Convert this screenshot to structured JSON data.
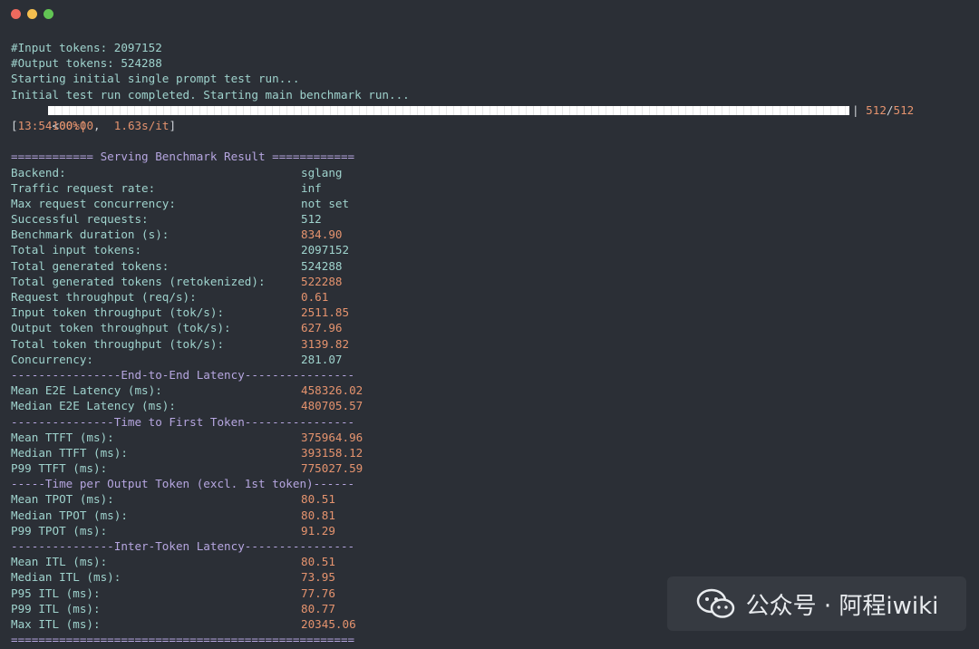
{
  "terminal": {
    "lines": {
      "input_tokens": "#Input tokens: 2097152",
      "output_tokens": "#Output tokens: 524288",
      "starting_initial": "Starting initial single prompt test run...",
      "initial_completed": "Initial test run completed. Starting main benchmark run..."
    },
    "progress": {
      "percent_text": "100%|",
      "fraction": 1.0,
      "count_sep": "| ",
      "count_done": "512",
      "count_slash": "/",
      "count_total": "512",
      "time_open": "[",
      "elapsed": "13:54",
      "time_lt": "<",
      "remaining": "00:00",
      "rate_sep": ",  ",
      "rate": "1.63s/it",
      "time_close": "]"
    },
    "header": "============ Serving Benchmark Result ============",
    "rows": [
      {
        "label": "Backend:",
        "value": "sglang",
        "tone": "cyan"
      },
      {
        "label": "Traffic request rate:",
        "value": "inf",
        "tone": "cyan"
      },
      {
        "label": "Max request concurrency:",
        "value": "not set",
        "tone": "cyan"
      },
      {
        "label": "Successful requests:",
        "value": "512",
        "tone": "cyan"
      },
      {
        "label": "Benchmark duration (s):",
        "value": "834.90",
        "tone": "orange"
      },
      {
        "label": "Total input tokens:",
        "value": "2097152",
        "tone": "cyan"
      },
      {
        "label": "Total generated tokens:",
        "value": "524288",
        "tone": "cyan"
      },
      {
        "label": "Total generated tokens (retokenized):",
        "value": "522288",
        "tone": "orange"
      },
      {
        "label": "Request throughput (req/s):",
        "value": "0.61",
        "tone": "orange"
      },
      {
        "label": "Input token throughput (tok/s):",
        "value": "2511.85",
        "tone": "orange"
      },
      {
        "label": "Output token throughput (tok/s):",
        "value": "627.96",
        "tone": "orange"
      },
      {
        "label": "Total token throughput (tok/s):",
        "value": "3139.82",
        "tone": "orange"
      },
      {
        "label": "Concurrency:",
        "value": "281.07",
        "tone": "cyan"
      }
    ],
    "sections": [
      {
        "title": "----------------End-to-End Latency----------------",
        "rows": [
          {
            "label": "Mean E2E Latency (ms):",
            "value": "458326.02"
          },
          {
            "label": "Median E2E Latency (ms):",
            "value": "480705.57"
          }
        ]
      },
      {
        "title": "---------------Time to First Token----------------",
        "rows": [
          {
            "label": "Mean TTFT (ms):",
            "value": "375964.96"
          },
          {
            "label": "Median TTFT (ms):",
            "value": "393158.12"
          },
          {
            "label": "P99 TTFT (ms):",
            "value": "775027.59"
          }
        ]
      },
      {
        "title": "-----Time per Output Token (excl. 1st token)------",
        "rows": [
          {
            "label": "Mean TPOT (ms):",
            "value": "80.51"
          },
          {
            "label": "Median TPOT (ms):",
            "value": "80.81"
          },
          {
            "label": "P99 TPOT (ms):",
            "value": "91.29"
          }
        ]
      },
      {
        "title": "---------------Inter-Token Latency----------------",
        "rows": [
          {
            "label": "Mean ITL (ms):",
            "value": "80.51"
          },
          {
            "label": "Median ITL (ms):",
            "value": "73.95"
          },
          {
            "label": "P95 ITL (ms):",
            "value": "77.76"
          },
          {
            "label": "P99 ITL (ms):",
            "value": "80.77"
          },
          {
            "label": "Max ITL (ms):",
            "value": "20345.06"
          }
        ]
      }
    ],
    "footer": "=================================================="
  },
  "watermark": {
    "text": "公众号 · 阿程iwiki",
    "icon": "wechat-icon"
  },
  "colors": {
    "background": "#2b2f36",
    "text_cyan": "#9fd3cd",
    "value_orange": "#e5936e",
    "header_purple": "#b6a6e0"
  }
}
